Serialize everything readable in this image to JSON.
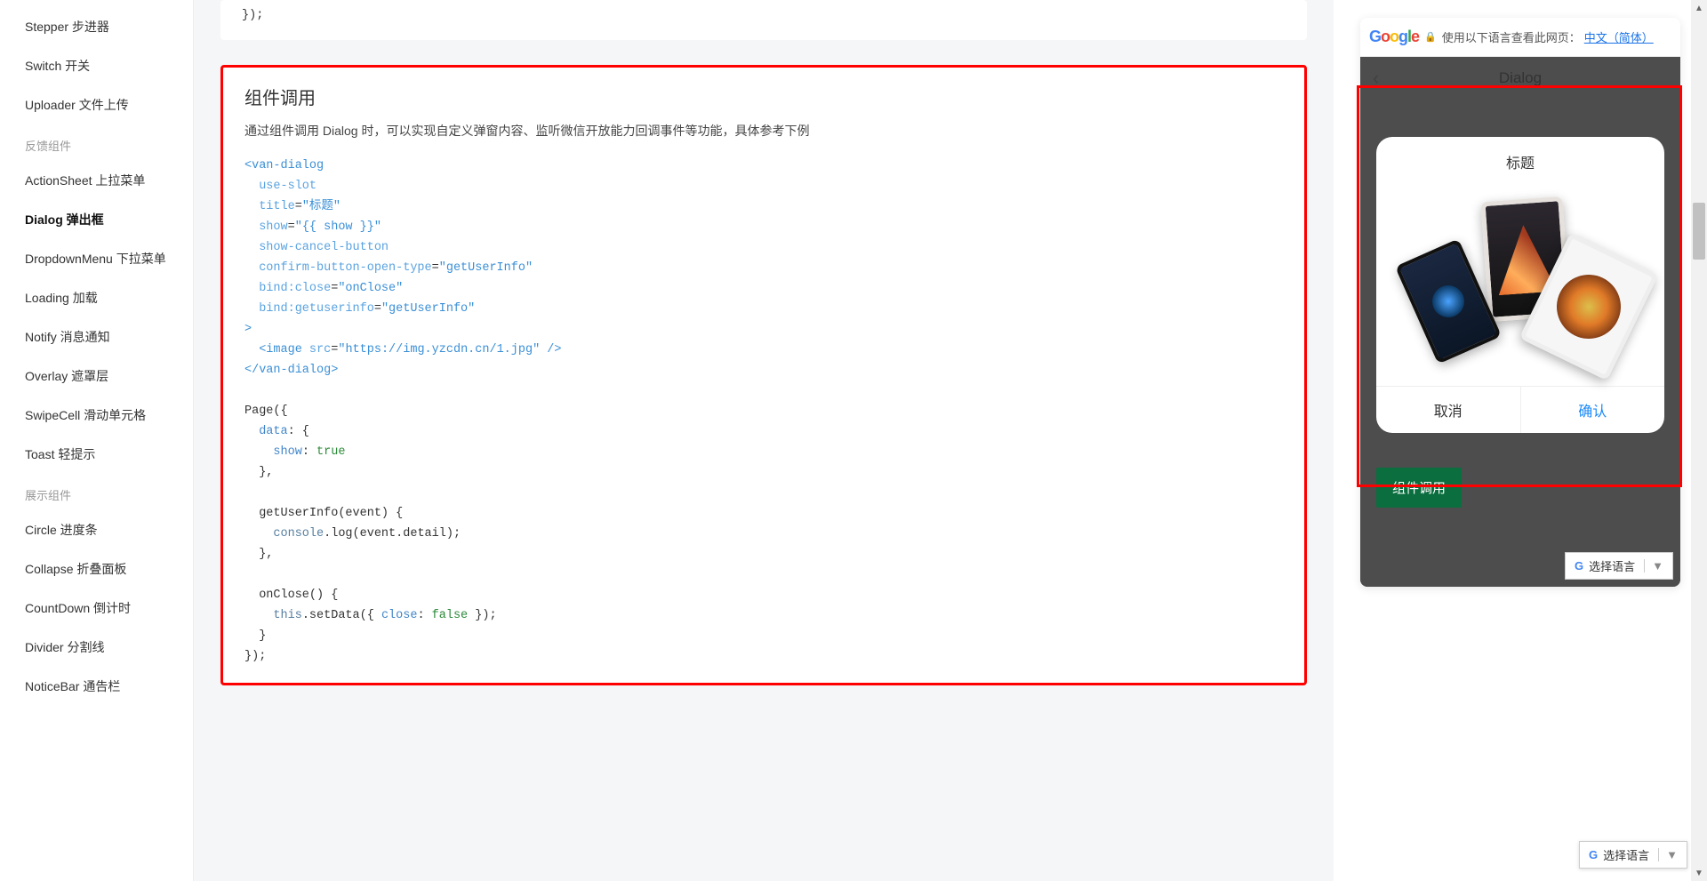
{
  "sidebar": {
    "items": [
      {
        "label": "Stepper 步进器",
        "current": false
      },
      {
        "label": "Switch 开关",
        "current": false
      },
      {
        "label": "Uploader 文件上传",
        "current": false
      }
    ],
    "section1": "反馈组件",
    "feedback": [
      {
        "label": "ActionSheet 上拉菜单",
        "current": false
      },
      {
        "label": "Dialog 弹出框",
        "current": true
      },
      {
        "label": "DropdownMenu 下拉菜单",
        "current": false
      },
      {
        "label": "Loading 加载",
        "current": false
      },
      {
        "label": "Notify 消息通知",
        "current": false
      },
      {
        "label": "Overlay 遮罩层",
        "current": false
      },
      {
        "label": "SwipeCell 滑动单元格",
        "current": false
      },
      {
        "label": "Toast 轻提示",
        "current": false
      }
    ],
    "section2": "展示组件",
    "display": [
      {
        "label": "Circle 进度条"
      },
      {
        "label": "Collapse 折叠面板"
      },
      {
        "label": "CountDown 倒计时"
      },
      {
        "label": "Divider 分割线"
      },
      {
        "label": "NoticeBar 通告栏"
      }
    ]
  },
  "doc": {
    "code_top": "});",
    "title": "组件调用",
    "desc": "通过组件调用 Dialog 时，可以实现自定义弹窗内容、监听微信开放能力回调事件等功能，具体参考下例",
    "code_block_1": "<van-dialog\n  use-slot\n  title=\"标题\"\n  show=\"{{ show }}\"\n  show-cancel-button\n  confirm-button-open-type=\"getUserInfo\"\n  bind:close=\"onClose\"\n  bind:getuserinfo=\"getUserInfo\"\n>\n  <image src=\"https://img.yzcdn.cn/1.jpg\" />\n</van-dialog>",
    "code_block_2": "Page({\n  data: {\n    show: true\n  },\n\n  getUserInfo(event) {\n    console.log(event.detail);\n  },\n\n  onClose() {\n    this.setData({ close: false });\n  }\n});"
  },
  "preview": {
    "gbar_text": "使用以下语言查看此网页：",
    "gbar_link": "中文（简体）",
    "app_title": "Dialog",
    "dialog_title": "标题",
    "cancel": "取消",
    "confirm": "确认",
    "behind_button": "组件调用",
    "lang_label": "选择语言"
  },
  "floater_label": "选择语言"
}
